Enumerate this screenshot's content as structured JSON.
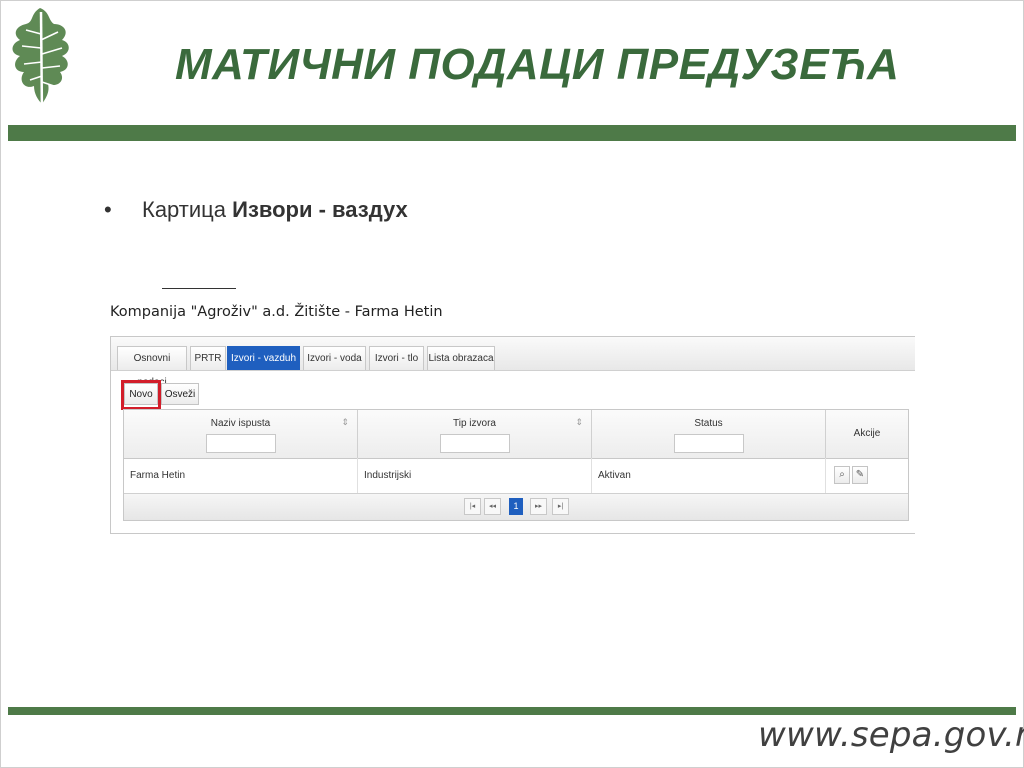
{
  "slide": {
    "title": "МАТИЧНИ ПОДАЦИ ПРЕДУЗЕЋА",
    "bullet_char": "•",
    "bullet_prefix": "Картица ",
    "bullet_bold": "Извори - ваздух",
    "footer_url": "www.sepa.gov.rs",
    "colors": {
      "brand_green": "#4e7a48",
      "title_green": "#3a6a3c",
      "highlight_red": "#d21d2a"
    }
  },
  "app": {
    "company_title": "Kompanija \"Agroživ\" a.d. Žitište - Farma Hetin",
    "tabs": [
      {
        "label": "Osnovni podaci",
        "active": false
      },
      {
        "label": "PRTR",
        "active": false
      },
      {
        "label": "Izvori - vazduh",
        "active": true
      },
      {
        "label": "Izvori - voda",
        "active": false
      },
      {
        "label": "Izvori - tlo",
        "active": false
      },
      {
        "label": "Lista obrazaca",
        "active": false
      }
    ],
    "toolbar": {
      "new_label": "Novo",
      "refresh_label": "Osveži"
    },
    "table": {
      "columns": [
        {
          "label": "Naziv ispusta",
          "sortable": true,
          "filter_value": ""
        },
        {
          "label": "Tip izvora",
          "sortable": true,
          "filter_value": ""
        },
        {
          "label": "Status",
          "sortable": false,
          "filter_value": ""
        },
        {
          "label": "Akcije",
          "sortable": false
        }
      ],
      "rows": [
        {
          "naziv": "Farma Hetin",
          "tip": "Industrijski",
          "status": "Aktivan"
        }
      ],
      "row_actions": [
        {
          "icon": "search-icon"
        },
        {
          "icon": "pencil-icon"
        }
      ]
    },
    "pager": {
      "current_page": "1",
      "first": "|◂",
      "prev": "◂◂",
      "next": "▸▸",
      "last": "▸|"
    },
    "accent_color": "#1f5fbf"
  }
}
